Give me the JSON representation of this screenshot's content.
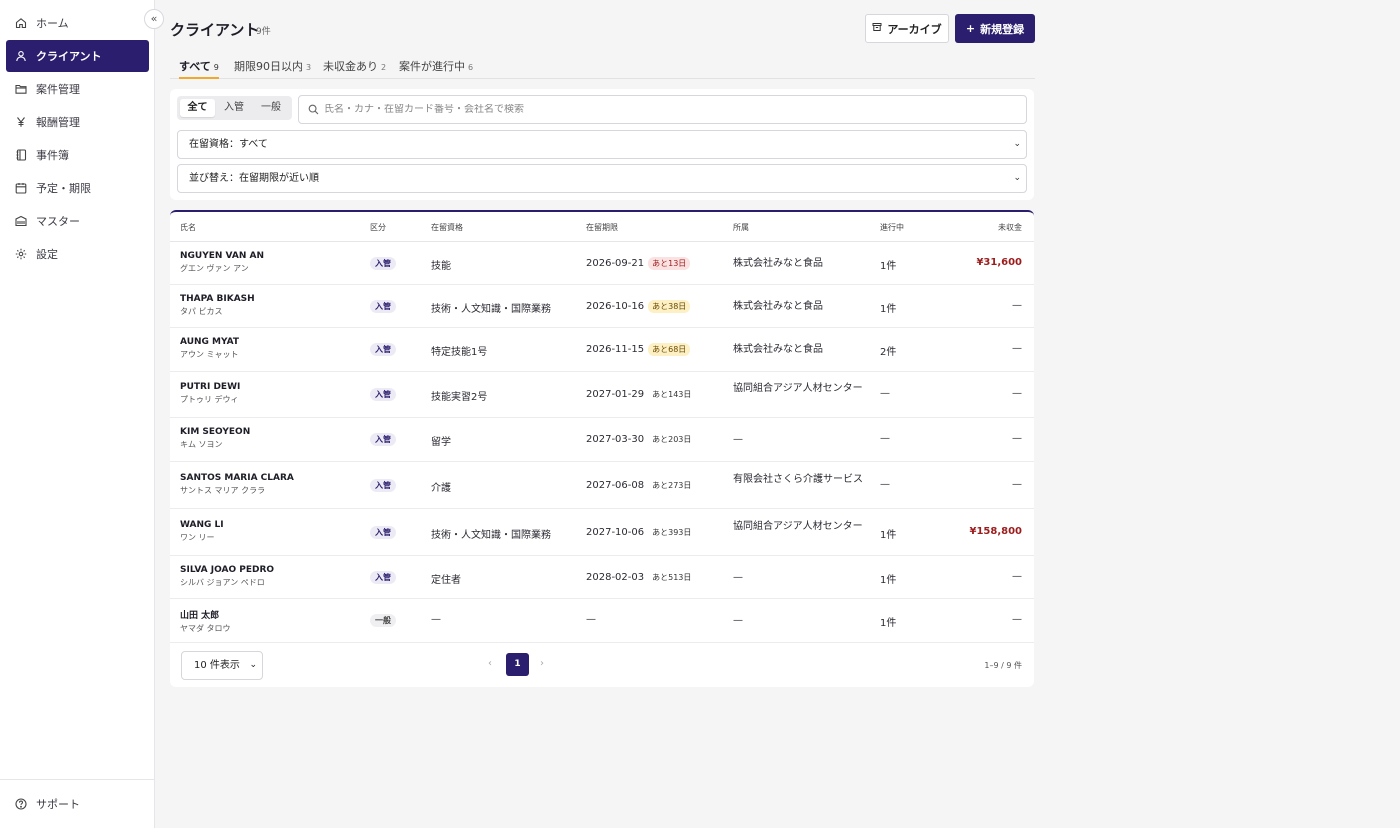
{
  "sidebar": {
    "collapse_label": "«",
    "items": [
      {
        "label": "ホーム",
        "icon": "home-icon"
      },
      {
        "label": "クライアント",
        "icon": "user-icon",
        "active": true
      },
      {
        "label": "案件管理",
        "icon": "folder-icon"
      },
      {
        "label": "報酬管理",
        "icon": "yen-icon"
      },
      {
        "label": "事件簿",
        "icon": "notebook-icon"
      },
      {
        "label": "予定・期限",
        "icon": "calendar-icon"
      },
      {
        "label": "マスター",
        "icon": "database-icon"
      },
      {
        "label": "設定",
        "icon": "gear-icon"
      }
    ],
    "support_label": "サポート"
  },
  "header": {
    "title": "クライアント",
    "count": "9件",
    "archive_label": "アーカイブ",
    "new_label": "新規登録",
    "new_icon": "+"
  },
  "tabs": [
    {
      "label": "すべて",
      "count": "9"
    },
    {
      "label": "期限90日以内",
      "count": "3"
    },
    {
      "label": "未収金あり",
      "count": "2"
    },
    {
      "label": "案件が進行中",
      "count": "6"
    }
  ],
  "filters": {
    "segments": [
      "全て",
      "入管",
      "一般"
    ],
    "search_placeholder": "氏名・カナ・在留カード番号・会社名で検索",
    "status_select": "在留資格：すべて",
    "sort_select": "並び替え：在留期限が近い順"
  },
  "table": {
    "headers": [
      "氏名",
      "区分",
      "在留資格",
      "在留期限",
      "所属",
      "進行中",
      "未収金"
    ],
    "rows": [
      {
        "name": "NGUYEN VAN AN",
        "kana": "グエン ヴァン アン",
        "type": "入管",
        "status": "技能",
        "expiry": "2026-09-21",
        "remain": "あと13日",
        "remain_style": "red",
        "org": "株式会社みなと食品",
        "active": "1件",
        "owed": "¥31,600"
      },
      {
        "name": "THAPA BIKASH",
        "kana": "タパ ビカス",
        "type": "入管",
        "status": "技術・人文知識・国際業務",
        "expiry": "2026-10-16",
        "remain": "あと38日",
        "remain_style": "yellow",
        "org": "株式会社みなと食品",
        "active": "1件",
        "owed": "—"
      },
      {
        "name": "AUNG MYAT",
        "kana": "アウン ミャット",
        "type": "入管",
        "status": "特定技能1号",
        "expiry": "2026-11-15",
        "remain": "あと68日",
        "remain_style": "yellow",
        "org": "株式会社みなと食品",
        "active": "2件",
        "owed": "—"
      },
      {
        "name": "PUTRI DEWI",
        "kana": "プトゥリ デウィ",
        "type": "入管",
        "status": "技能実習2号",
        "expiry": "2027-01-29",
        "remain": "あと143日",
        "remain_style": "plain",
        "org": "協同組合アジア人材センター",
        "active": "—",
        "owed": "—"
      },
      {
        "name": "KIM SEOYEON",
        "kana": "キム ソヨン",
        "type": "入管",
        "status": "留学",
        "expiry": "2027-03-30",
        "remain": "あと203日",
        "remain_style": "plain",
        "org": "—",
        "active": "—",
        "owed": "—"
      },
      {
        "name": "SANTOS MARIA CLARA",
        "kana": "サントス マリア クララ",
        "type": "入管",
        "status": "介護",
        "expiry": "2027-06-08",
        "remain": "あと273日",
        "remain_style": "plain",
        "org": "有限会社さくら介護サービス",
        "active": "—",
        "owed": "—"
      },
      {
        "name": "WANG LI",
        "kana": "ワン リー",
        "type": "入管",
        "status": "技術・人文知識・国際業務",
        "expiry": "2027-10-06",
        "remain": "あと393日",
        "remain_style": "plain",
        "org": "協同組合アジア人材センター",
        "active": "1件",
        "owed": "¥158,800"
      },
      {
        "name": "SILVA JOAO PEDRO",
        "kana": "シルバ ジョアン ペドロ",
        "type": "入管",
        "status": "定住者",
        "expiry": "2028-02-03",
        "remain": "あと513日",
        "remain_style": "plain",
        "org": "—",
        "active": "1件",
        "owed": "—"
      },
      {
        "name": "山田 太郎",
        "kana": "ヤマダ タロウ",
        "type": "一般",
        "status": "—",
        "expiry": "—",
        "remain": "",
        "remain_style": "plain",
        "org": "—",
        "active": "1件",
        "owed": "—"
      }
    ]
  },
  "pagination": {
    "page_size": "10 件表示",
    "prev": "‹",
    "current": "1",
    "next": "›",
    "info": "1–9 / 9 件"
  },
  "colors": {
    "accent": "#2b1e6e",
    "tab_underline": "#f0a92d",
    "owed": "#9b1c1c"
  }
}
